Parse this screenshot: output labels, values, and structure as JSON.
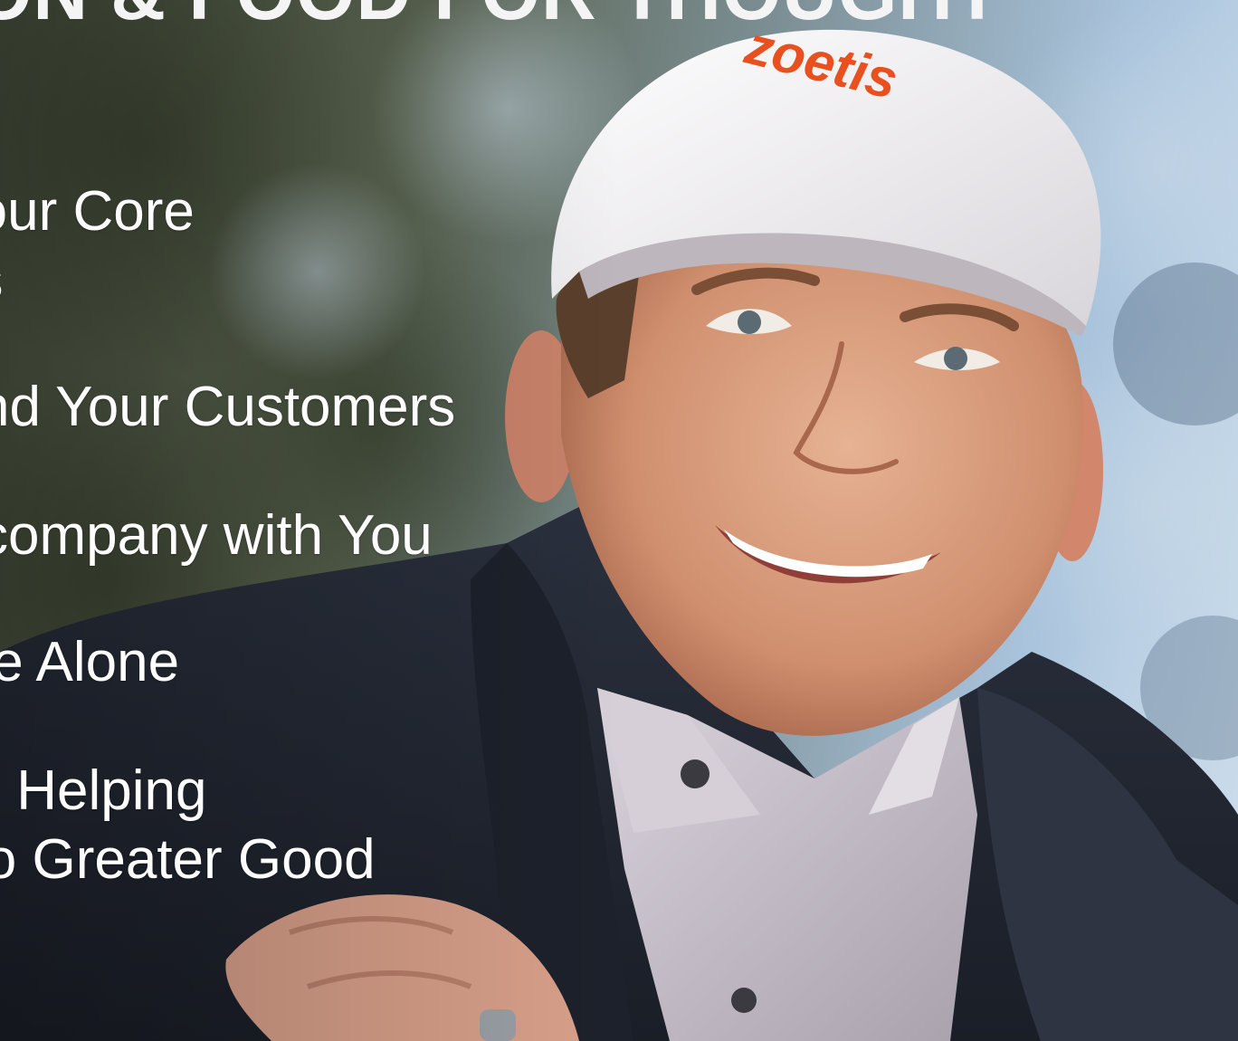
{
  "slide": {
    "title": "ON & FOOD FOR THOUGHT",
    "bullets": [
      {
        "line1": "Your Core",
        "line2": "es"
      },
      {
        "line1": "nd Your Customers"
      },
      {
        "line1": "company with You"
      },
      {
        "line1": "te Alone"
      },
      {
        "line1": "s Helping",
        "line2": "lo Greater Good"
      }
    ]
  },
  "photo": {
    "cap_logo": "zoetis",
    "colors": {
      "cap": "#f1eff0",
      "logo": "#e8511f",
      "jacket": "#252b38",
      "shirt": "#c9c2cb",
      "skin": "#d69a7a",
      "sky": "#a9c3dc"
    }
  }
}
